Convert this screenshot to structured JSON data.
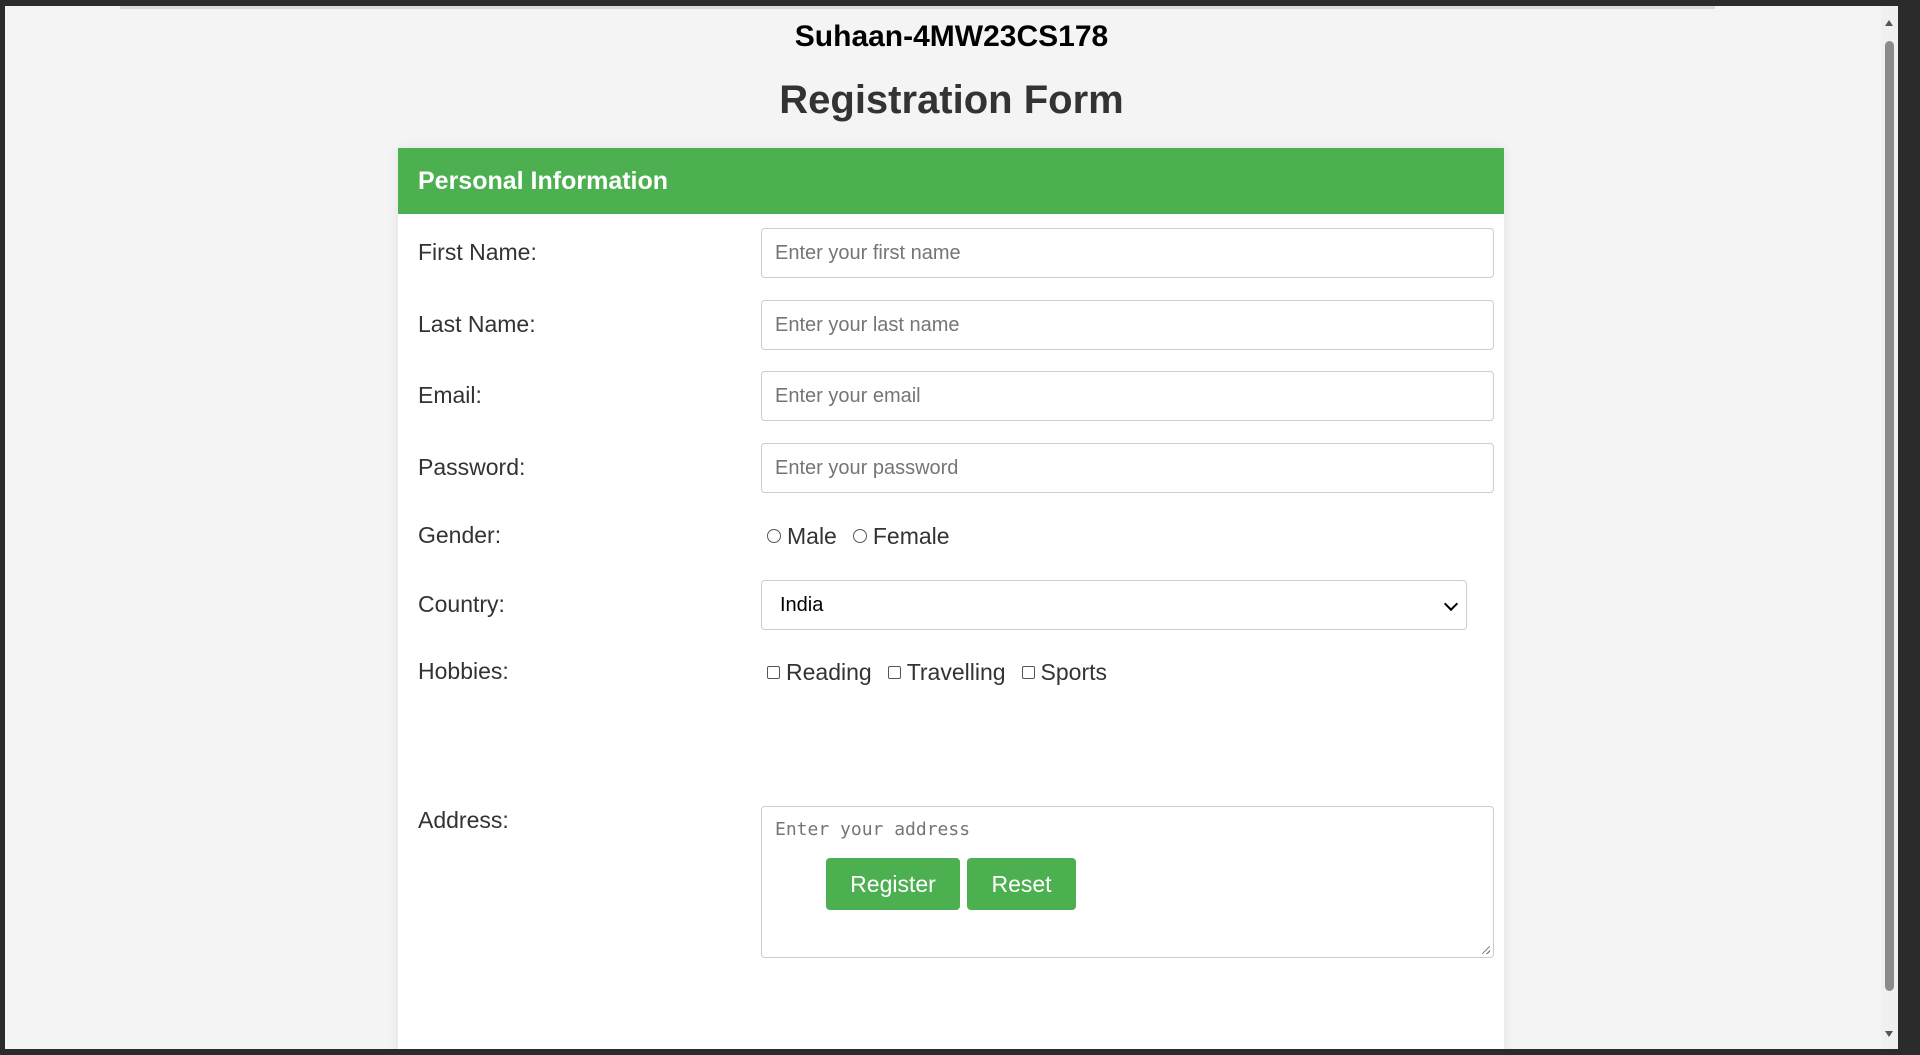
{
  "page": {
    "header": "Suhaan-4MW23CS178",
    "title": "Registration Form"
  },
  "section": {
    "title": "Personal Information"
  },
  "fields": {
    "first_name": {
      "label": "First Name:",
      "placeholder": "Enter your first name",
      "value": ""
    },
    "last_name": {
      "label": "Last Name:",
      "placeholder": "Enter your last name",
      "value": ""
    },
    "email": {
      "label": "Email:",
      "placeholder": "Enter your email",
      "value": ""
    },
    "password": {
      "label": "Password:",
      "placeholder": "Enter your password",
      "value": ""
    },
    "gender": {
      "label": "Gender:",
      "options": [
        "Male",
        "Female"
      ],
      "selected": null
    },
    "country": {
      "label": "Country:",
      "selected": "India"
    },
    "hobbies": {
      "label": "Hobbies:",
      "options": [
        "Reading",
        "Travelling",
        "Sports"
      ],
      "checked": []
    },
    "address": {
      "label": "Address:",
      "placeholder": "Enter your address",
      "value": ""
    }
  },
  "buttons": {
    "register": "Register",
    "reset": "Reset"
  },
  "colors": {
    "accent": "#4caf50",
    "page_background": "#f4f4f4",
    "card_background": "#ffffff"
  },
  "icons": {
    "select_caret": "chevron-down-icon",
    "resize": "resize-grip-icon"
  }
}
